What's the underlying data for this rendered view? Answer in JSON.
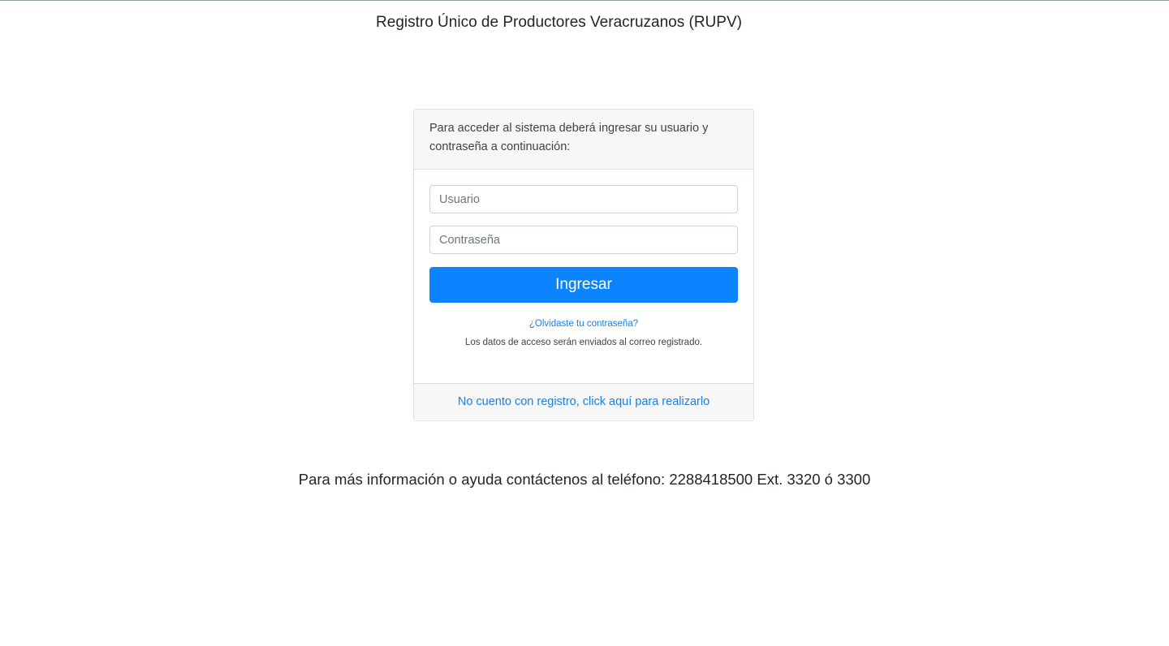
{
  "header": {
    "title": "Registro Único de Productores Veracruzanos (RUPV)"
  },
  "login_card": {
    "instructions": "Para acceder al sistema deberá ingresar su usuario y contraseña a continuación:",
    "username_placeholder": "Usuario",
    "username_value": "",
    "password_placeholder": "Contraseña",
    "password_value": "",
    "submit_label": "Ingresar",
    "forgot_password_link": "¿Olvidaste tu contraseña?",
    "access_note": "Los datos de acceso serán enviados al correo registrado.",
    "register_link": "No cuento con registro, click aquí para realizarlo"
  },
  "footer": {
    "contact_text": "Para más información o ayuda contáctenos al teléfono: 2288418500 Ext. 3320 ó 3300"
  },
  "colors": {
    "primary_button": "#0d84ff",
    "link": "#1a7fe0",
    "card_header_bg": "#f7f7f7",
    "card_border": "#dcdfe2"
  }
}
